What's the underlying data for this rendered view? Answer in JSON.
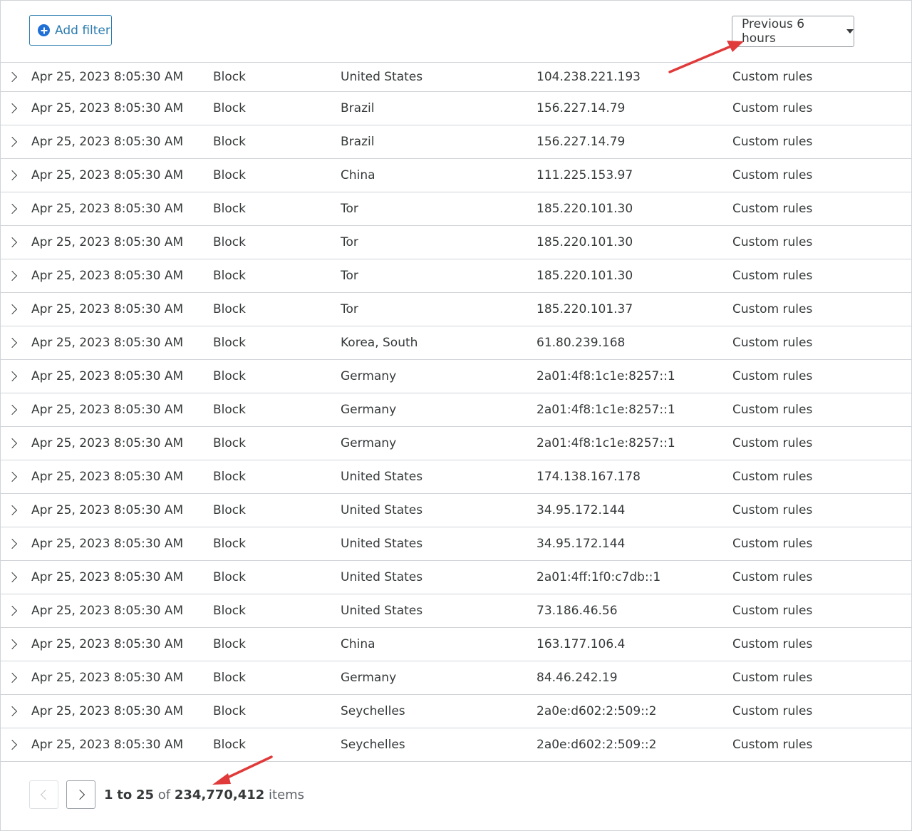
{
  "toolbar": {
    "add_filter_label": "Add filter",
    "time_range": "Previous 6 hours"
  },
  "events": [
    {
      "date": "Apr 25, 2023 8:05:30 AM",
      "action": "Block",
      "country": "United States",
      "ip": "104.238.221.193",
      "service": "Custom rules"
    },
    {
      "date": "Apr 25, 2023 8:05:30 AM",
      "action": "Block",
      "country": "Brazil",
      "ip": "156.227.14.79",
      "service": "Custom rules"
    },
    {
      "date": "Apr 25, 2023 8:05:30 AM",
      "action": "Block",
      "country": "Brazil",
      "ip": "156.227.14.79",
      "service": "Custom rules"
    },
    {
      "date": "Apr 25, 2023 8:05:30 AM",
      "action": "Block",
      "country": "China",
      "ip": "111.225.153.97",
      "service": "Custom rules"
    },
    {
      "date": "Apr 25, 2023 8:05:30 AM",
      "action": "Block",
      "country": "Tor",
      "ip": "185.220.101.30",
      "service": "Custom rules"
    },
    {
      "date": "Apr 25, 2023 8:05:30 AM",
      "action": "Block",
      "country": "Tor",
      "ip": "185.220.101.30",
      "service": "Custom rules"
    },
    {
      "date": "Apr 25, 2023 8:05:30 AM",
      "action": "Block",
      "country": "Tor",
      "ip": "185.220.101.30",
      "service": "Custom rules"
    },
    {
      "date": "Apr 25, 2023 8:05:30 AM",
      "action": "Block",
      "country": "Tor",
      "ip": "185.220.101.37",
      "service": "Custom rules"
    },
    {
      "date": "Apr 25, 2023 8:05:30 AM",
      "action": "Block",
      "country": "Korea, South",
      "ip": "61.80.239.168",
      "service": "Custom rules"
    },
    {
      "date": "Apr 25, 2023 8:05:30 AM",
      "action": "Block",
      "country": "Germany",
      "ip": "2a01:4f8:1c1e:8257::1",
      "service": "Custom rules"
    },
    {
      "date": "Apr 25, 2023 8:05:30 AM",
      "action": "Block",
      "country": "Germany",
      "ip": "2a01:4f8:1c1e:8257::1",
      "service": "Custom rules"
    },
    {
      "date": "Apr 25, 2023 8:05:30 AM",
      "action": "Block",
      "country": "Germany",
      "ip": "2a01:4f8:1c1e:8257::1",
      "service": "Custom rules"
    },
    {
      "date": "Apr 25, 2023 8:05:30 AM",
      "action": "Block",
      "country": "United States",
      "ip": "174.138.167.178",
      "service": "Custom rules"
    },
    {
      "date": "Apr 25, 2023 8:05:30 AM",
      "action": "Block",
      "country": "United States",
      "ip": "34.95.172.144",
      "service": "Custom rules"
    },
    {
      "date": "Apr 25, 2023 8:05:30 AM",
      "action": "Block",
      "country": "United States",
      "ip": "34.95.172.144",
      "service": "Custom rules"
    },
    {
      "date": "Apr 25, 2023 8:05:30 AM",
      "action": "Block",
      "country": "United States",
      "ip": "2a01:4ff:1f0:c7db::1",
      "service": "Custom rules"
    },
    {
      "date": "Apr 25, 2023 8:05:30 AM",
      "action": "Block",
      "country": "United States",
      "ip": "73.186.46.56",
      "service": "Custom rules"
    },
    {
      "date": "Apr 25, 2023 8:05:30 AM",
      "action": "Block",
      "country": "China",
      "ip": "163.177.106.4",
      "service": "Custom rules"
    },
    {
      "date": "Apr 25, 2023 8:05:30 AM",
      "action": "Block",
      "country": "Germany",
      "ip": "84.46.242.19",
      "service": "Custom rules"
    },
    {
      "date": "Apr 25, 2023 8:05:30 AM",
      "action": "Block",
      "country": "Seychelles",
      "ip": "2a0e:d602:2:509::2",
      "service": "Custom rules"
    },
    {
      "date": "Apr 25, 2023 8:05:30 AM",
      "action": "Block",
      "country": "Seychelles",
      "ip": "2a0e:d602:2:509::2",
      "service": "Custom rules"
    }
  ],
  "pagination": {
    "range_start": "1",
    "to_word": "to",
    "range_end": "25",
    "of_word": "of",
    "total": "234,770,412",
    "unit": "items"
  },
  "colors": {
    "annotation_arrow": "#e03a3a",
    "accent": "#2c7cb0"
  }
}
